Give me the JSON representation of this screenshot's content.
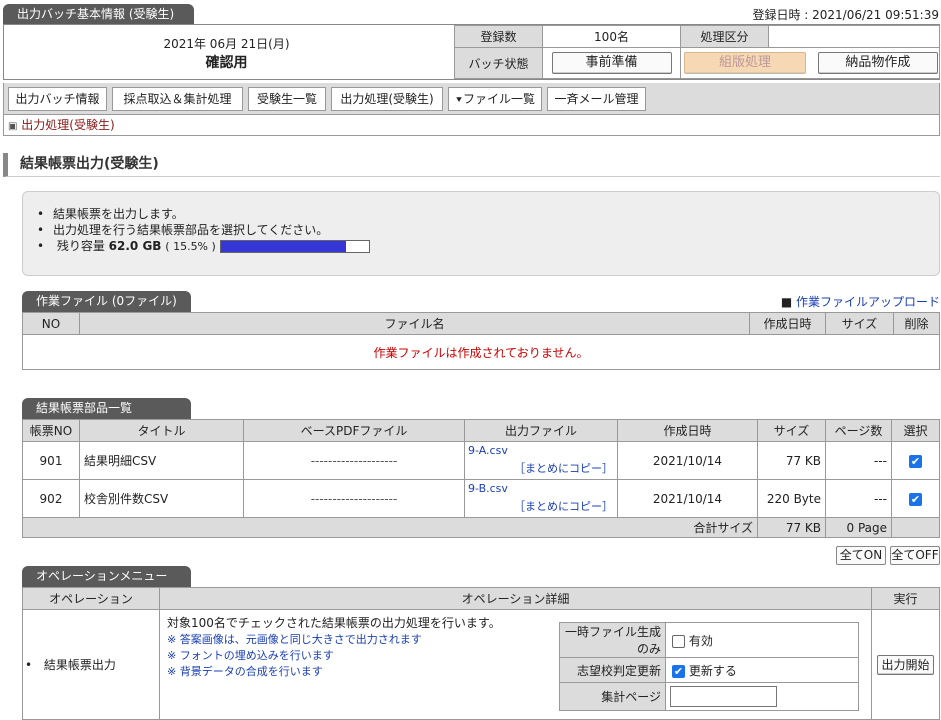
{
  "header": {
    "tab_label": "出力バッチ基本情報 (受験生)",
    "registered_datetime": "登録日時 : 2021/06/21 09:51:39",
    "date": "2021年 06月 21日(月)",
    "status": "確認用",
    "count_label": "登録数",
    "count_value": "100名",
    "process_label": "処理区分",
    "process_value": "",
    "batch_state_label": "バッチ状態",
    "btn_prepare": "事前準備",
    "btn_layout": "組版処理",
    "btn_deliver": "納品物作成"
  },
  "nav": {
    "tabs": [
      "出力バッチ情報",
      "採点取込＆集計処理",
      "受験生一覧",
      "出力処理(受験生)",
      "ファイル一覧",
      "一斉メール管理"
    ],
    "file_list_icon": "double-chevron-down-icon",
    "breadcrumb": "出力処理(受験生)"
  },
  "section_title": "結果帳票出力(受験生)",
  "info": {
    "line1": "結果帳票を出力します。",
    "line2": "出力処理を行う結果帳票部品を選択してください。",
    "capacity_label": "残り容量",
    "capacity_value": "62.0 GB",
    "capacity_percent": "( 15.5% )",
    "capacity_bar_fraction": 0.85,
    "bar_color": "#3737d8"
  },
  "work_files": {
    "tab_label": "作業ファイル (0ファイル)",
    "upload_link": "作業ファイルアップロード",
    "columns": [
      "NO",
      "ファイル名",
      "作成日時",
      "サイズ",
      "削除"
    ],
    "empty_message": "作業ファイルは作成されておりません。"
  },
  "parts": {
    "tab_label": "結果帳票部品一覧",
    "columns": [
      "帳票NO",
      "タイトル",
      "ベースPDFファイル",
      "出力ファイル",
      "作成日時",
      "サイズ",
      "ページ数",
      "選択"
    ],
    "rows": [
      {
        "no": "901",
        "title": "結果明細CSV",
        "base_pdf": "--------------------",
        "output_file": "9-A.csv",
        "copy_link": "［まとめにコピー］",
        "created": "2021/10/14",
        "size": "77 KB",
        "pages": "---",
        "selected": true
      },
      {
        "no": "902",
        "title": "校舎別件数CSV",
        "base_pdf": "--------------------",
        "output_file": "9-B.csv",
        "copy_link": "［まとめにコピー］",
        "created": "2021/10/14",
        "size": "220 Byte",
        "pages": "---",
        "selected": true
      }
    ],
    "total_label": "合計サイズ",
    "total_size": "77 KB",
    "total_pages": "0 Page",
    "btn_all_on": "全てON",
    "btn_all_off": "全てOFF"
  },
  "operation": {
    "tab_label": "オペレーションメニュー",
    "columns": [
      "オペレーション",
      "オペレーション詳細",
      "実行"
    ],
    "name": "結果帳票出力",
    "description": "対象100名でチェックされた結果帳票の出力処理を行います。",
    "notes": [
      "※ 答案画像は、元画像と同じ大きさで出力されます",
      "※ フォントの埋め込みを行います",
      "※ 背景データの合成を行います"
    ],
    "opt_temp_label": "一時ファイル生成のみ",
    "opt_temp_value": "有効",
    "opt_temp_checked": false,
    "opt_school_label": "志望校判定更新",
    "opt_school_value": "更新する",
    "opt_school_checked": true,
    "opt_page_label": "集計ページ",
    "opt_page_value": "",
    "run_button": "出力開始"
  }
}
